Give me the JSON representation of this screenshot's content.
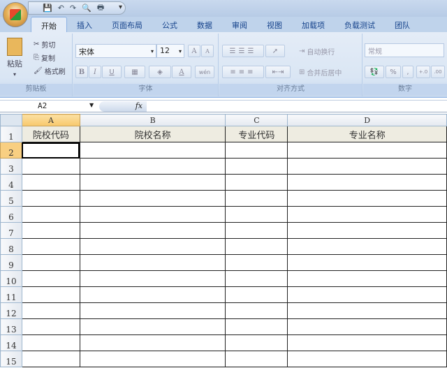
{
  "quick_access": {
    "save": "💾",
    "undo": "↶",
    "redo": "↷",
    "preview": "🔍",
    "print": "🖶",
    "more": "▾"
  },
  "tabs": [
    "开始",
    "插入",
    "页面布局",
    "公式",
    "数据",
    "审阅",
    "视图",
    "加载项",
    "负载测试",
    "团队"
  ],
  "active_tab": "开始",
  "clipboard": {
    "paste": "粘贴",
    "cut": "剪切",
    "copy": "复制",
    "format_painter": "格式刷",
    "label": "剪贴板"
  },
  "font": {
    "name": "宋体",
    "size": "12",
    "grow": "A",
    "shrink": "A",
    "bold": "B",
    "italic": "I",
    "underline": "U",
    "phonetic": "wén",
    "label": "字体"
  },
  "alignment": {
    "wrap_text": "自动换行",
    "merge_center": "合并后居中",
    "label": "对齐方式"
  },
  "number": {
    "format": "常规",
    "percent": "%",
    "comma": ",",
    "inc_decimal": "+.0",
    "dec_decimal": ".00",
    "label": "数字"
  },
  "formula_bar": {
    "name_box": "A2",
    "fx": "fx",
    "value": ""
  },
  "columns": [
    "A",
    "B",
    "C",
    "D"
  ],
  "rows": [
    "1",
    "2",
    "3",
    "4",
    "5",
    "6",
    "7",
    "8",
    "9",
    "10",
    "11",
    "12",
    "13",
    "14",
    "15"
  ],
  "header_row": [
    "院校代码",
    "院校名称",
    "专业代码",
    "专业名称"
  ],
  "selected_cell": "A2"
}
